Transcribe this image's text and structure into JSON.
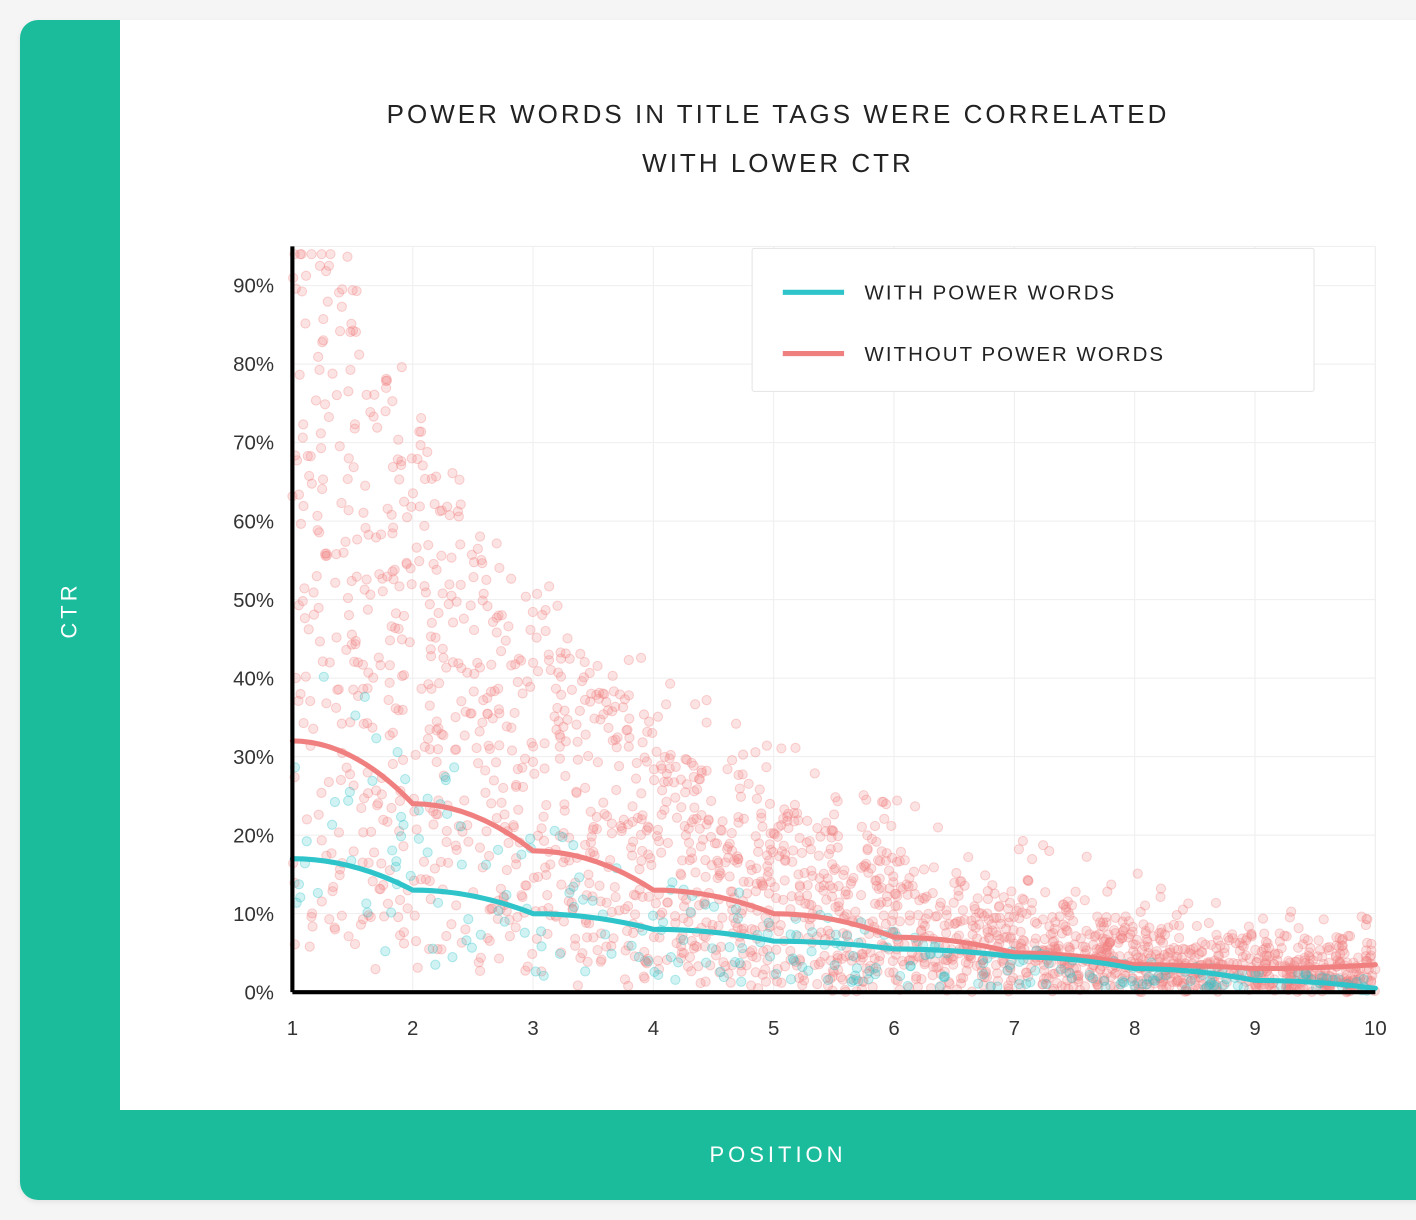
{
  "title_line1": "POWER WORDS IN TITLE TAGS WERE CORRELATED",
  "title_line2": "WITH LOWER CTR",
  "ylabel": "CTR",
  "xlabel": "POSITION",
  "legend": {
    "series1": "WITH POWER WORDS",
    "series2": "WITHOUT POWER WORDS"
  },
  "colors": {
    "accent": "#1abc9c",
    "series1": "#2ec4c9",
    "series2": "#f08080"
  },
  "chart_data": {
    "type": "line",
    "xlabel": "POSITION",
    "ylabel": "CTR",
    "xlim": [
      1,
      10
    ],
    "ylim": [
      0,
      95
    ],
    "x_ticks": [
      1,
      2,
      3,
      4,
      5,
      6,
      7,
      8,
      9,
      10
    ],
    "y_ticks": [
      0,
      10,
      20,
      30,
      40,
      50,
      60,
      70,
      80,
      90
    ],
    "y_tick_labels": [
      "0%",
      "10%",
      "20%",
      "30%",
      "40%",
      "50%",
      "60%",
      "70%",
      "80%",
      "90%"
    ],
    "series": [
      {
        "name": "WITH POWER WORDS",
        "color": "#2ec4c9",
        "x": [
          1,
          2,
          3,
          4,
          5,
          6,
          7,
          8,
          9,
          10
        ],
        "y": [
          17,
          13,
          10,
          8,
          6.5,
          5.5,
          4.5,
          3,
          1.5,
          0.5
        ]
      },
      {
        "name": "WITHOUT POWER WORDS",
        "color": "#f08080",
        "x": [
          1,
          2,
          3,
          4,
          5,
          6,
          7,
          8,
          9,
          10
        ],
        "y": [
          32,
          24,
          18,
          13,
          10,
          7,
          5,
          3.5,
          3,
          3.5
        ]
      }
    ],
    "scatter_note": "Dense scatter of individual data points (lighter opacity) behind the trend lines; predominantly red (without power words), sparse teal (with power words). Points show CTR vs Position, heavily clustered at low positions with high variance, tapering toward position 10 at low CTR.",
    "title": "POWER WORDS IN TITLE TAGS WERE CORRELATED WITH LOWER CTR",
    "legend_position": "top-right",
    "grid": true
  }
}
